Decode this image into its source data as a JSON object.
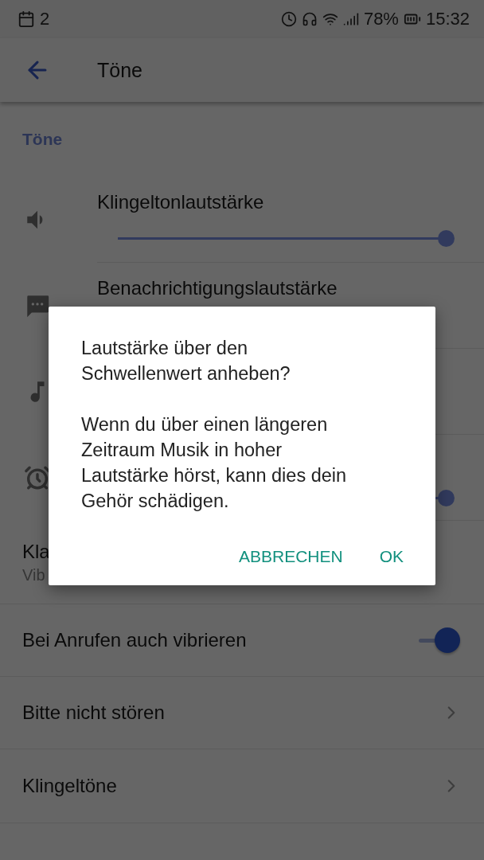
{
  "status_bar": {
    "notification_count": "2",
    "battery": "78%",
    "time": "15:32"
  },
  "app_bar": {
    "title": "Töne"
  },
  "section": {
    "title": "Töne"
  },
  "volume_rows": [
    {
      "kind": "ring",
      "label": "Klingeltonlautstärke",
      "level": 1
    },
    {
      "kind": "notification",
      "label": "Benachrichtigungslautstärke"
    },
    {
      "kind": "media"
    },
    {
      "kind": "alarm",
      "level": 1
    }
  ],
  "settings": [
    {
      "kind": "text",
      "title": "Kla",
      "subtitle": "Vib"
    },
    {
      "kind": "switch",
      "title": "Bei Anrufen auch vibrieren",
      "on": true
    },
    {
      "kind": "link",
      "title": "Bitte nicht stören"
    },
    {
      "kind": "link",
      "title": "Klingeltöne"
    }
  ],
  "dialog": {
    "title": "Lautstärke über den Schwellenwert anheben?",
    "message": "Wenn du über einen längeren Zeitraum Musik in hoher Lautstärke hörst, kann dies dein Gehör schädigen.",
    "buttons": [
      "ABBRECHEN",
      "OK"
    ]
  }
}
